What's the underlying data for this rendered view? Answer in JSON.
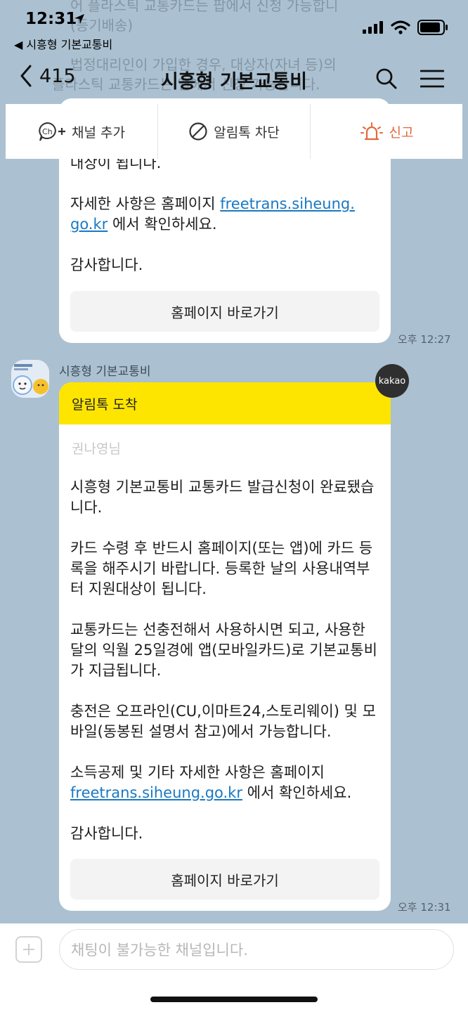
{
  "status": {
    "time": "12:31",
    "back_app": "◀ 시흥형 기본교통비"
  },
  "ghost_lines": [
    "어 플라스틱 교통카드는 팝에서 신청 가능합니",
    "(등기배송)",
    "법정대리인이 가입한 경우, 대상자(자녀 등)의",
    "플라스틱 교통카드는 앱에서 신청 가능합니다."
  ],
  "nav": {
    "back_count": "415",
    "title": "시흥형 기본교통비"
  },
  "actions": {
    "add_channel": "채널 추가",
    "block": "알림톡 차단",
    "report": "신고"
  },
  "message1": {
    "cut_line": "대상이 됩니다.",
    "info_prefix": "자세한 사항은 홈페이지 ",
    "link_a": "freetrans.siheung.",
    "link_b": "go.kr",
    "info_suffix": " 에서 확인하세요.",
    "thanks": "감사합니다.",
    "button": "홈페이지 바로가기",
    "time": "오후 12:27"
  },
  "sender": {
    "name": "시흥형 기본교통비",
    "badge": "kakao"
  },
  "message2": {
    "header": "알림톡 도착",
    "recipient": "권나영님",
    "p1": "시흥형 기본교통비 교통카드 발급신청이 완료됐습니다.",
    "p2": "카드 수령 후 반드시 홈페이지(또는 앱)에 카드 등록을 해주시기 바랍니다. 등록한 날의 사용내역부터 지원대상이 됩니다.",
    "p3": "교통카드는 선충전해서 사용하시면 되고, 사용한 달의 익월 25일경에 앱(모바일카드)로 기본교통비가 지급됩니다.",
    "p4": "충전은 오프라인(CU,이마트24,스토리웨이) 및 모바일(동봉된 설명서 참고)에서 가능합니다.",
    "info_prefix": "소득공제 및 기타 자세한 사항은 홈페이지 ",
    "link_a": "free",
    "link_b": "trans.siheung.go.kr",
    "info_suffix": " 에서 확인하세요.",
    "thanks": "감사합니다.",
    "button": "홈페이지 바로가기",
    "time": "오후 12:31"
  },
  "input": {
    "placeholder": "채팅이 불가능한 채널입니다."
  },
  "colors": {
    "background": "#abc1d1",
    "alimtalk_yellow": "#fde500",
    "link": "#1a78c2",
    "report": "#e2683c"
  }
}
